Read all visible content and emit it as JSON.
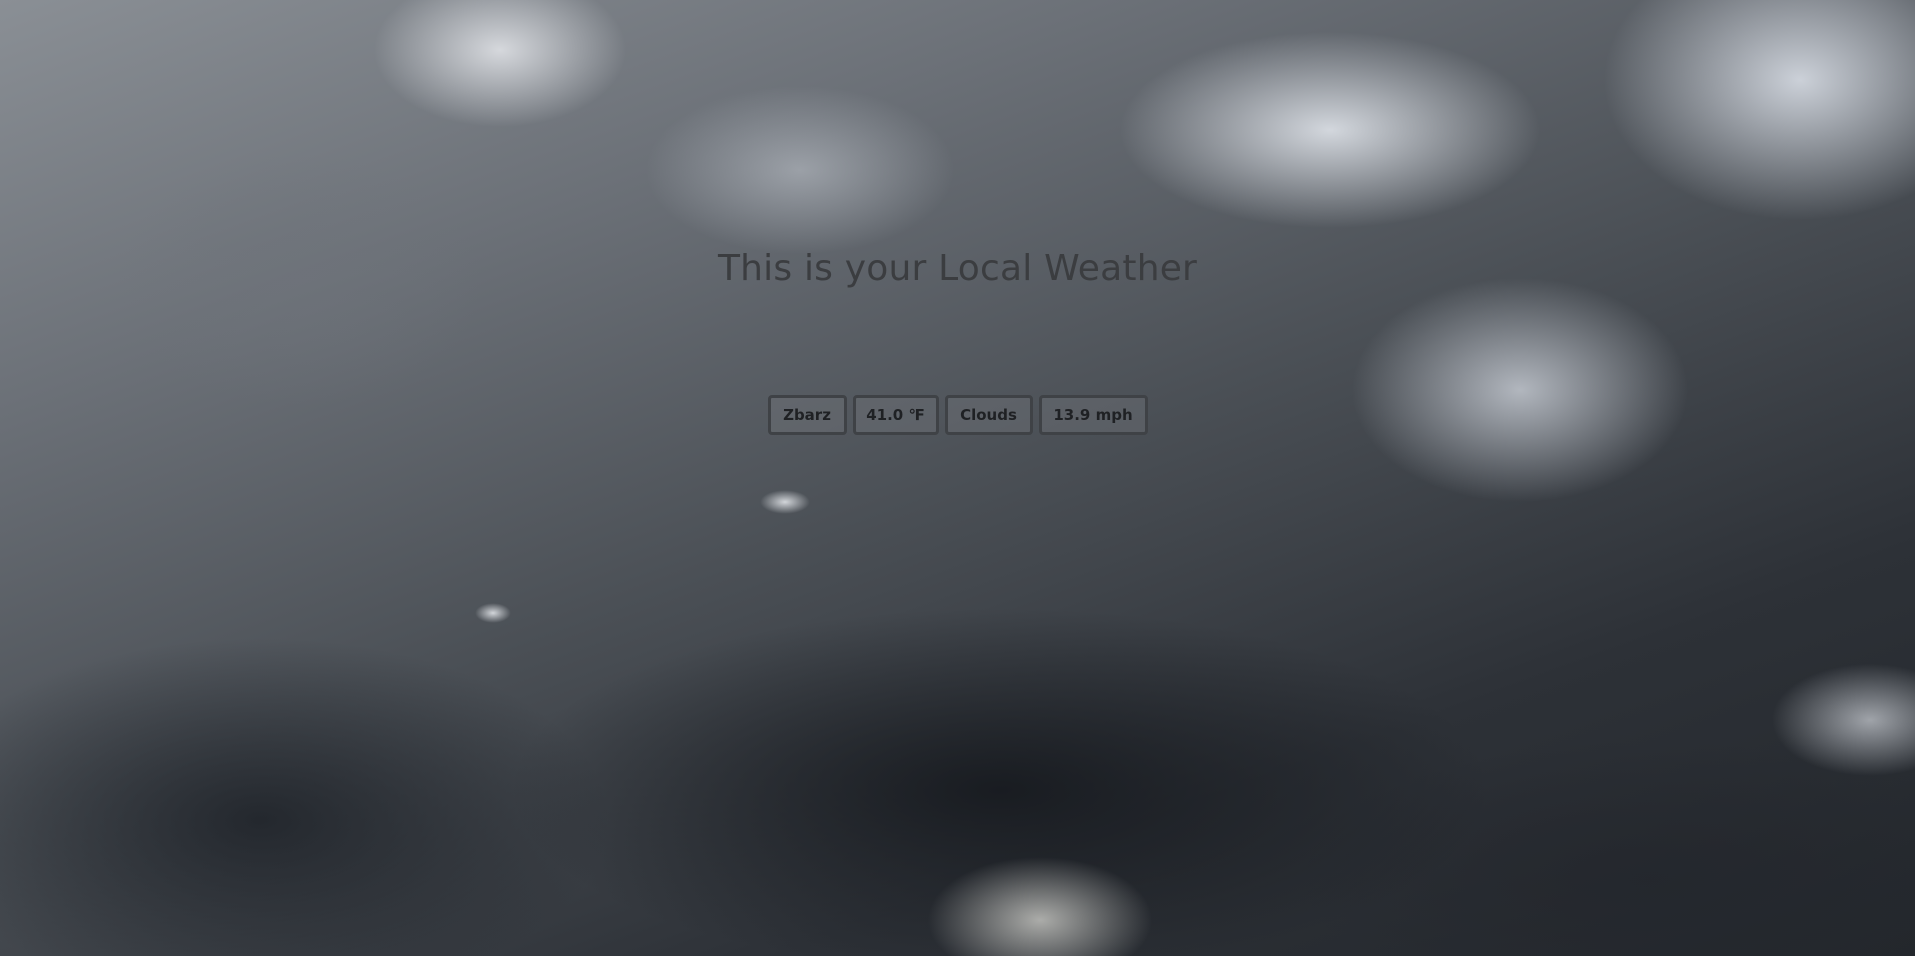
{
  "page": {
    "title": "This is your Local Weather"
  },
  "weather": {
    "location": "Zbarz",
    "temperature": "41.0 ℉",
    "condition": "Clouds",
    "wind_speed": "13.9 mph"
  },
  "colors": {
    "title_text": "#3b3d40",
    "badge_border": "#3f4246",
    "badge_text": "#1f2124"
  }
}
